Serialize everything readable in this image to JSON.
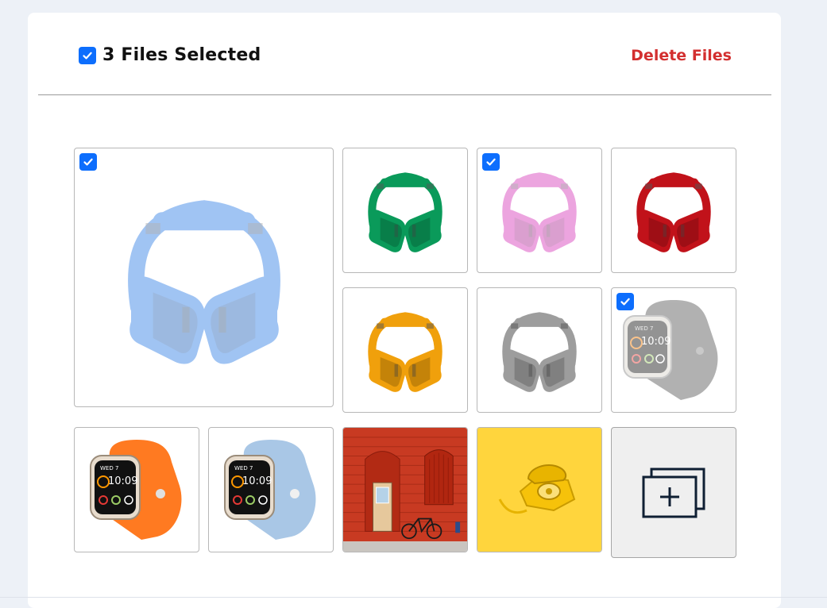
{
  "header": {
    "title": "3 Files Selected",
    "delete_label": "Delete Files",
    "select_all_checked": true
  },
  "colors": {
    "accent": "#0d6efd",
    "danger": "#d32f2f",
    "page_bg": "#edf1f7"
  },
  "gallery": {
    "tiles": [
      {
        "name": "headphones-blue",
        "selected": true
      },
      {
        "name": "headphones-green",
        "selected": false
      },
      {
        "name": "headphones-pink",
        "selected": true
      },
      {
        "name": "headphones-red",
        "selected": false
      },
      {
        "name": "headphones-orange",
        "selected": false
      },
      {
        "name": "headphones-silver",
        "selected": false
      },
      {
        "name": "watch-gray",
        "selected": true
      },
      {
        "name": "watch-orange",
        "selected": false
      },
      {
        "name": "watch-light-blue",
        "selected": false
      },
      {
        "name": "red-wall-bicycle",
        "selected": false
      },
      {
        "name": "yellow-telephone",
        "selected": false
      }
    ],
    "watch_time": "10:09",
    "watch_date": "WED 7",
    "add_icon": "add-images-icon"
  }
}
